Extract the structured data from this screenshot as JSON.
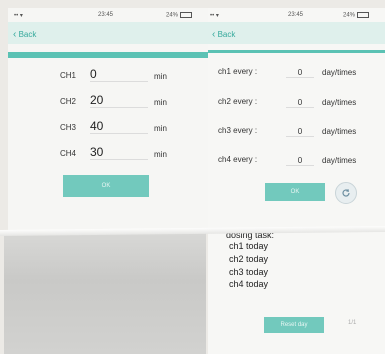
{
  "left_screen": {
    "status": {
      "signal": "•• ▾",
      "time": "23:45",
      "battery": "24%"
    },
    "back_label": "Back",
    "channels": [
      {
        "label": "CH1",
        "value": "0",
        "unit": "min"
      },
      {
        "label": "CH2",
        "value": "20",
        "unit": "min"
      },
      {
        "label": "CH3",
        "value": "40",
        "unit": "min"
      },
      {
        "label": "CH4",
        "value": "30",
        "unit": "min"
      }
    ],
    "ok_label": "OK"
  },
  "right_screen": {
    "status": {
      "signal": "•• ▾",
      "time": "23:45",
      "battery": "24%"
    },
    "back_label": "Back",
    "rows": [
      {
        "label": "ch1 every :",
        "value": "0",
        "unit": "day/times"
      },
      {
        "label": "ch2 every :",
        "value": "0",
        "unit": "day/times"
      },
      {
        "label": "ch3 every :",
        "value": "0",
        "unit": "day/times"
      },
      {
        "label": "ch4 every :",
        "value": "0",
        "unit": "day/times"
      }
    ],
    "ok_label": "OK",
    "dosing_title": "dosing task:",
    "tasks": [
      "ch1 today",
      "ch2 today",
      "ch3 today",
      "ch4 today"
    ],
    "bottom_button_label": "Reset day",
    "page_hint": "1/1",
    "colors": {
      "accent": "#5bc2b4",
      "button": "#72c9bd",
      "nav": "#dff0ec"
    }
  }
}
